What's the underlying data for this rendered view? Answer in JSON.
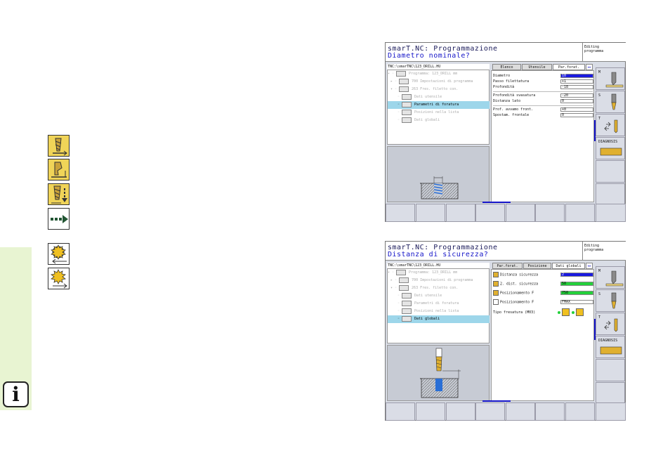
{
  "left_icons": [
    "drill-thread-icon",
    "drill-depth-icon",
    "drill-step-icon",
    "more-arrow-icon",
    "mill-climb-icon",
    "mill-conventional-icon"
  ],
  "screen1": {
    "title": "smarT.NC: Programmazione",
    "prompt": "Diametro nominale?",
    "mode": [
      "Editing",
      "programma"
    ],
    "path": "TNC:\\smarTNC\\123_DRILL.HU",
    "tree": [
      {
        "label": "Programma: 123_DRILL mm",
        "prefix": "▾ ◦"
      },
      {
        "label": "700 Impostazioni di programma",
        "prefix": "▸ ◦"
      },
      {
        "label": "263 Fres. filetto con.",
        "prefix": "▾ ◦"
      },
      {
        "label": "Dati utensile",
        "prefix": "◦"
      },
      {
        "label": "Parametri di foratura",
        "prefix": "◦"
      },
      {
        "label": "Posizioni nella lista",
        "prefix": "◦"
      },
      {
        "label": "Dati globali",
        "prefix": "◦"
      }
    ],
    "tabs": [
      "Elenco",
      "Utensile",
      "Par.forat.",
      "◂▸"
    ],
    "form": [
      {
        "label": "Diametro",
        "value": "10",
        "style": "blue"
      },
      {
        "label": "Passo filettatura",
        "value": "+1",
        "style": ""
      },
      {
        "label": "Profondità",
        "value": "-18",
        "style": ""
      },
      {
        "label": "Profondità svasatura",
        "value": "-20",
        "style": ""
      },
      {
        "label": "Distanza lato",
        "value": "0",
        "style": ""
      },
      {
        "label": "Prof. avvamo front.",
        "value": "+0",
        "style": ""
      },
      {
        "label": "Spostam. frontale",
        "value": "0",
        "style": ""
      }
    ],
    "softkeys": [
      "M",
      "S",
      "T",
      "DIAGNOSIS",
      "",
      ""
    ]
  },
  "screen2": {
    "title": "smarT.NC: Programmazione",
    "prompt": "Distanza di sicurezza?",
    "mode": [
      "Editing",
      "programma"
    ],
    "path": "TNC:\\smarTNC\\123_DRILL.HU",
    "tree": [
      {
        "label": "Programma: 123_DRILL mm",
        "prefix": "▾ ◦"
      },
      {
        "label": "700 Impostazioni di programma",
        "prefix": "▸ ◦"
      },
      {
        "label": "263 Fres. filetto con.",
        "prefix": "▾ ◦"
      },
      {
        "label": "Dati utensile",
        "prefix": "◦"
      },
      {
        "label": "Parametri di foratura",
        "prefix": "◦"
      },
      {
        "label": "Posizioni nella lista",
        "prefix": "◦"
      },
      {
        "label": "Dati globali",
        "prefix": "◦"
      }
    ],
    "tabs": [
      "Par.forat.",
      "Posizione",
      "Dati globali",
      "◂▸"
    ],
    "form": [
      {
        "label": "Distanza sicurezza",
        "value": "2",
        "style": "blue"
      },
      {
        "label": "2. dist. sicurezza",
        "value": "50",
        "style": "green"
      },
      {
        "label": "Posizionamento F",
        "value": "750",
        "style": "green"
      },
      {
        "label": "Posizionamento F",
        "value": "FMAX",
        "style": ""
      }
    ],
    "milling_label": "Tipo fresatura (M03)",
    "softkeys": [
      "M",
      "S",
      "T",
      "DIAGNOSIS",
      "",
      ""
    ]
  }
}
